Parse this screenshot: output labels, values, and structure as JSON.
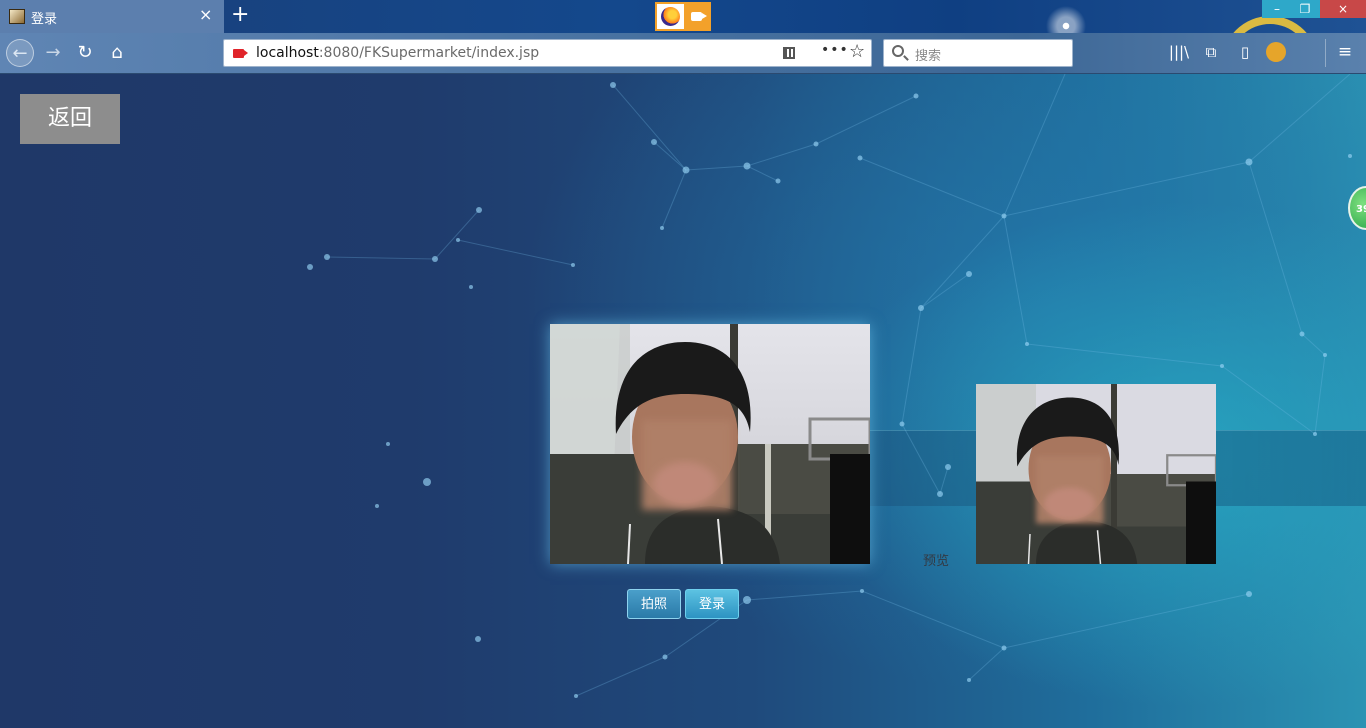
{
  "browser": {
    "tab_title": "登录",
    "tab_close": "×",
    "new_tab": "+",
    "url_host": "localhost",
    "url_rest": ":8080/FKSupermarket/index.jsp",
    "url_more": "•••",
    "url_star": "☆",
    "search_placeholder": "搜索",
    "menu_icon": "≡",
    "library_icon": "|||\\",
    "sync_icon": "⧉",
    "sidebar_icon": "▯",
    "window_min": "–",
    "window_max": "❐",
    "window_close": "×",
    "nav_back": "←",
    "nav_forward": "→",
    "nav_reload": "↻",
    "nav_home": "⌂"
  },
  "page": {
    "back_label": "返回",
    "preview_label": "预览",
    "take_photo_label": "拍照",
    "login_label": "登录",
    "float_badge": "39"
  },
  "colors": {
    "accent": "#2d93c2",
    "back_button": "#8d8d8d",
    "background_dark": "#1f3868",
    "background_light": "#2b93b3"
  }
}
